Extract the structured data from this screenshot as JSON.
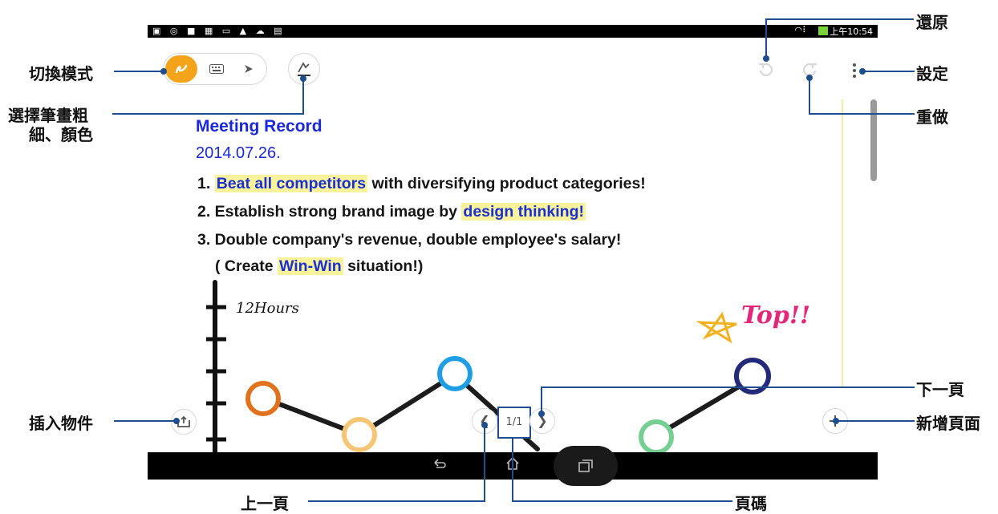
{
  "status_bar": {
    "left_icons": "▣ ◎ ■ ▦ ▭ ▲ ☁ ▤",
    "time": "上午10:54",
    "signal": "◠⠇"
  },
  "toolbar": {
    "mode_handwrite_icon": "handwrite-icon",
    "mode_keyboard_icon": "keyboard-icon",
    "mode_pen_icon": "pen-icon",
    "brush_icon": "brush-color-icon",
    "undo_icon": "undo-icon",
    "redo_icon": "redo-icon",
    "menu_icon": "more-vertical-icon"
  },
  "note": {
    "title": "Meeting Record",
    "date": "2014.07.26.",
    "line1_prefix": "1. ",
    "line1_highlight": "Beat all competitors",
    "line1_suffix": " with diversifying product categories!",
    "line2_prefix": "2. Establish strong brand image by ",
    "line2_highlight": "design thinking!",
    "line3": "3. Double company's revenue, double employee's salary!",
    "line4_prefix": "( Create ",
    "line4_highlight": "Win-Win",
    "line4_suffix": " situation!)",
    "sketch_hours": "12Hours",
    "sketch_top": "Top!!"
  },
  "pager": {
    "page_number": "1/1",
    "prev_glyph": "❮",
    "next_glyph": "❯"
  },
  "insert_icon": "insert-object-icon",
  "add_page_icon": "add-page-icon",
  "callouts": {
    "switch_mode": "切換模式",
    "brush_line1": "選擇筆畫粗",
    "brush_line2": "細、顏色",
    "undo": "還原",
    "settings": "設定",
    "redo": "重做",
    "insert": "插入物件",
    "next_page": "下一頁",
    "add_page": "新增頁面",
    "prev_page": "上一頁",
    "page_number": "頁碼"
  },
  "colors": {
    "accent_orange": "#f3a41a",
    "text_blue": "#1a28d8",
    "highlight_yellow": "#f8f29a",
    "callout_line": "#1f4e8f"
  }
}
